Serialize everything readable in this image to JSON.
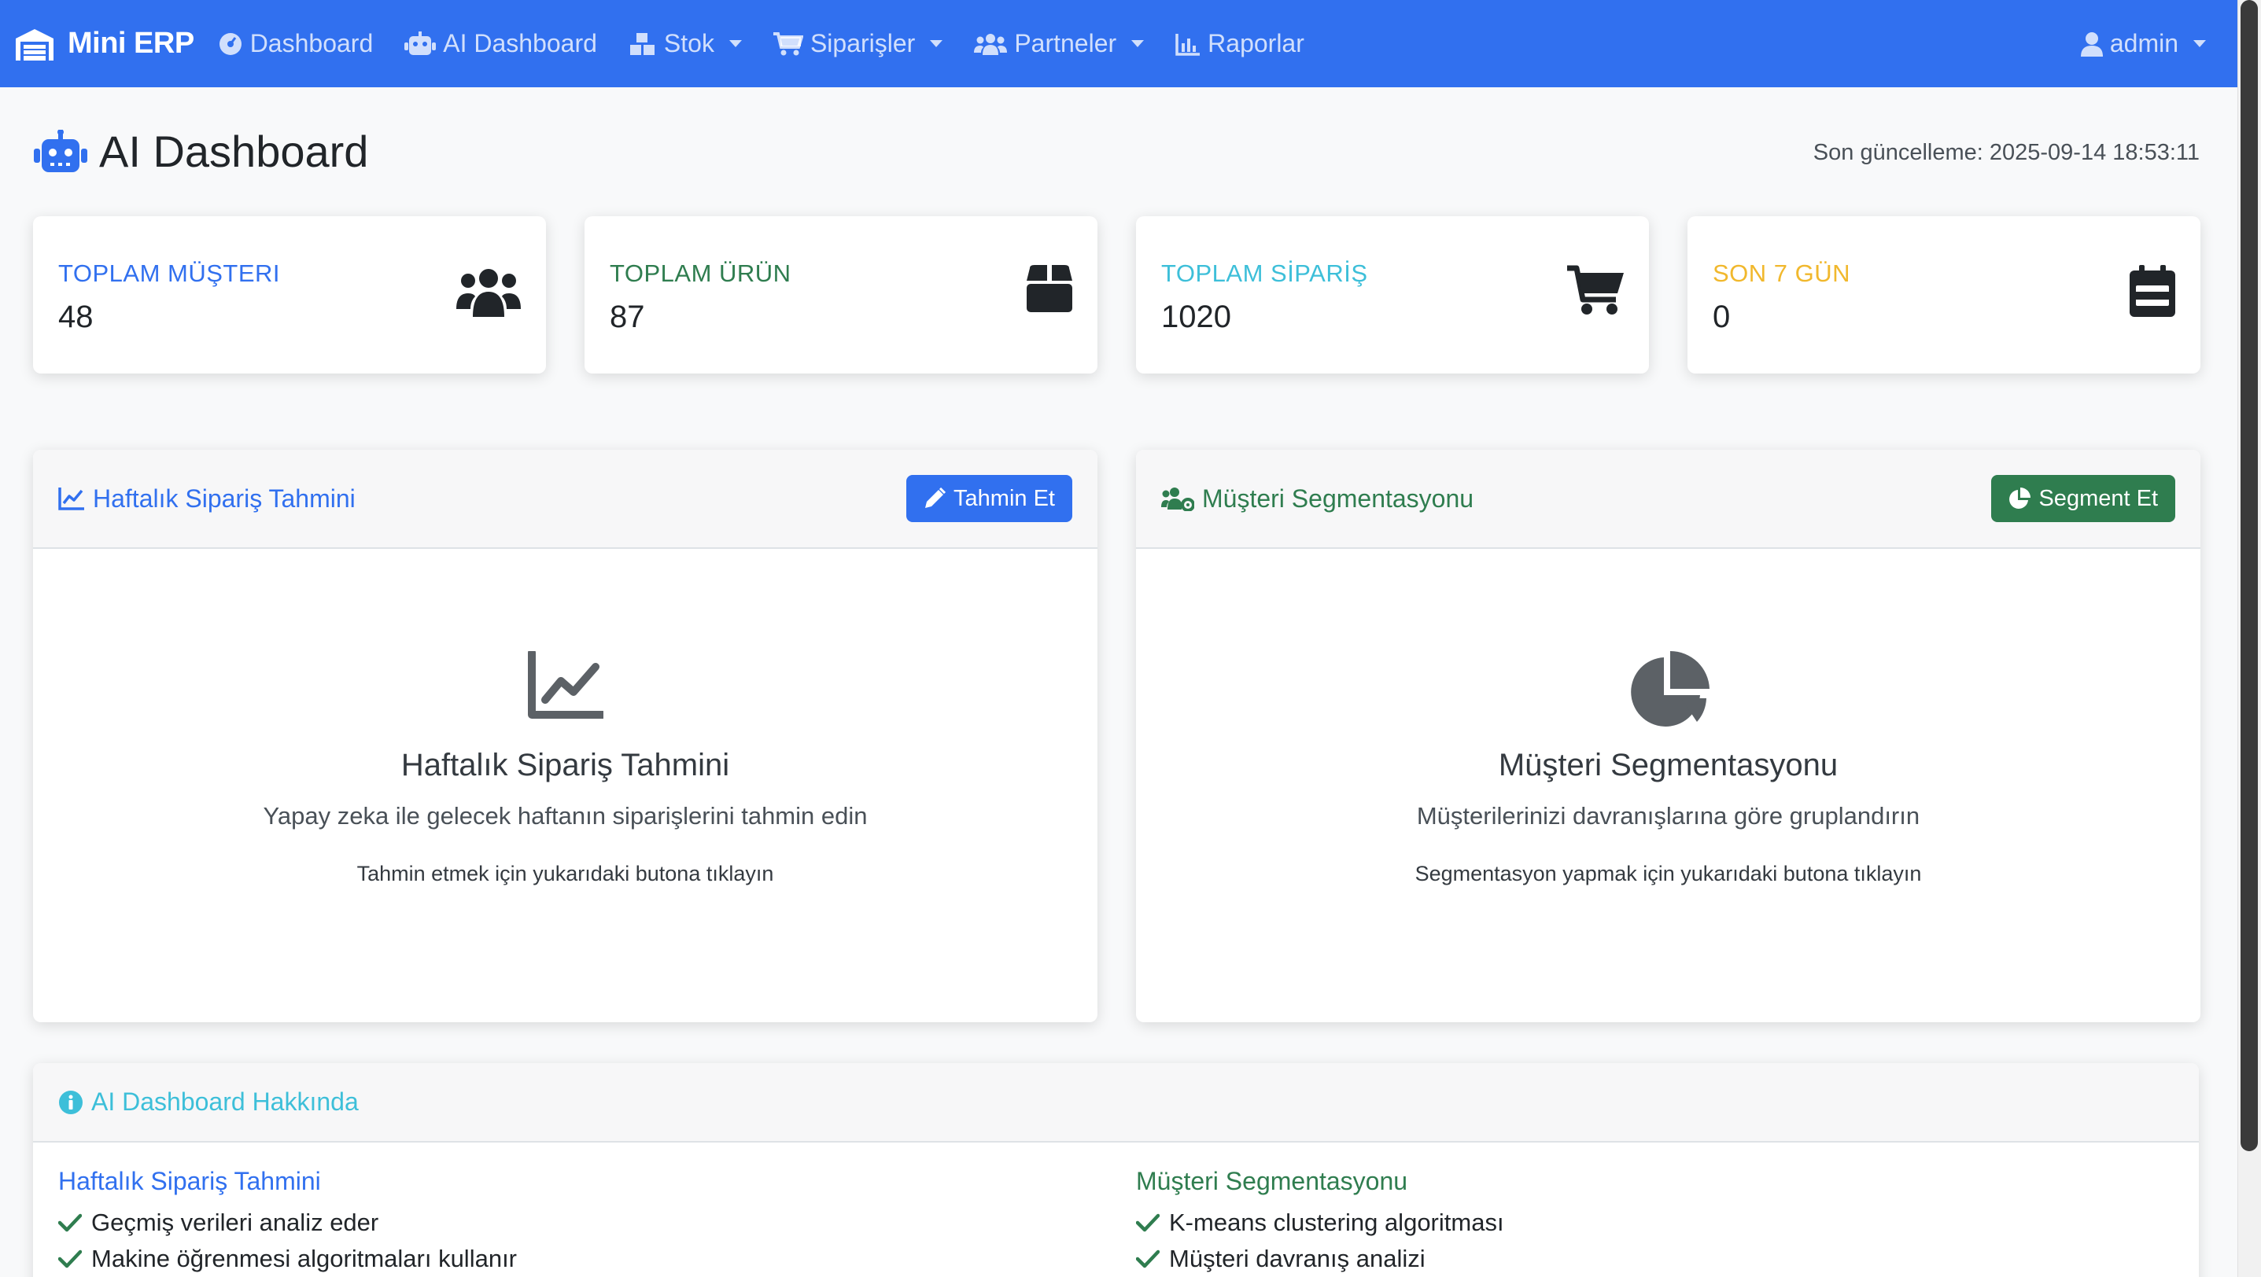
{
  "navbar": {
    "brand": "Mini ERP",
    "items": [
      {
        "label": "Dashboard",
        "icon": "gauge-icon",
        "dropdown": false
      },
      {
        "label": "AI Dashboard",
        "icon": "robot-icon",
        "dropdown": false
      },
      {
        "label": "Stok",
        "icon": "boxes-icon",
        "dropdown": true
      },
      {
        "label": "Siparişler",
        "icon": "cart-icon",
        "dropdown": true
      },
      {
        "label": "Partneler",
        "icon": "users-icon",
        "dropdown": true
      },
      {
        "label": "Raporlar",
        "icon": "chart-bar-icon",
        "dropdown": false
      }
    ],
    "user": "admin"
  },
  "header": {
    "title": "AI Dashboard",
    "updated": "Son güncelleme: 2025-09-14 18:53:11"
  },
  "stats": [
    {
      "label": "TOPLAM MÜŞTERI",
      "value": "48",
      "color": "#3170ef",
      "icon": "users-icon"
    },
    {
      "label": "TOPLAM ÜRÜN",
      "value": "87",
      "color": "#2f7d4f",
      "icon": "box-icon"
    },
    {
      "label": "TOPLAM SİPARİŞ",
      "value": "1020",
      "color": "#3dbfd9",
      "icon": "cart-icon"
    },
    {
      "label": "SON 7 GÜN",
      "value": "0",
      "color": "#f1b82d",
      "icon": "calendar-icon"
    }
  ],
  "forecast": {
    "header": "Haftalık Sipariş Tahmini",
    "button": "Tahmin Et",
    "title": "Haftalık Sipariş Tahmini",
    "subtitle": "Yapay zeka ile gelecek haftanın siparişlerini tahmin edin",
    "hint": "Tahmin etmek için yukarıdaki butona tıklayın",
    "color": "#3170ef"
  },
  "segmentation": {
    "header": "Müşteri Segmentasyonu",
    "button": "Segment Et",
    "title": "Müşteri Segmentasyonu",
    "subtitle": "Müşterilerinizi davranışlarına göre gruplandırın",
    "hint": "Segmentasyon yapmak için yukarıdaki butona tıklayın",
    "color": "#2f7d4f"
  },
  "about": {
    "title": "AI Dashboard Hakkında",
    "forecast_col": {
      "title": "Haftalık Sipariş Tahmini",
      "items": [
        "Geçmiş verileri analiz eder",
        "Makine öğrenmesi algoritmaları kullanır"
      ]
    },
    "segment_col": {
      "title": "Müşteri Segmentasyonu",
      "items": [
        "K-means clustering algoritması",
        "Müşteri davranış analizi"
      ]
    }
  }
}
